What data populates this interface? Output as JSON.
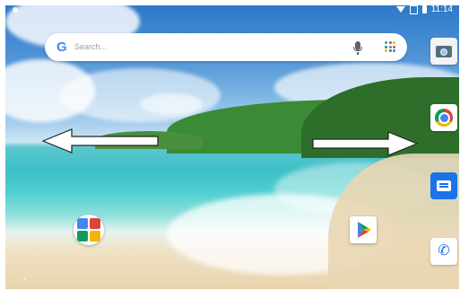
{
  "status_bar": {
    "time": "11:14"
  },
  "search_bar": {
    "logo_text": "G",
    "placeholder": "Search..."
  },
  "dock": [
    "Camera",
    "Chrome",
    "Messages",
    "Phone"
  ],
  "home_icons": [
    "Folder",
    "Play Store"
  ],
  "colors": {
    "google_blue": "#4285F4",
    "google_red": "#DB4437",
    "google_yellow": "#F4B400",
    "google_green": "#0F9D58",
    "arrow": "#ffffff"
  }
}
